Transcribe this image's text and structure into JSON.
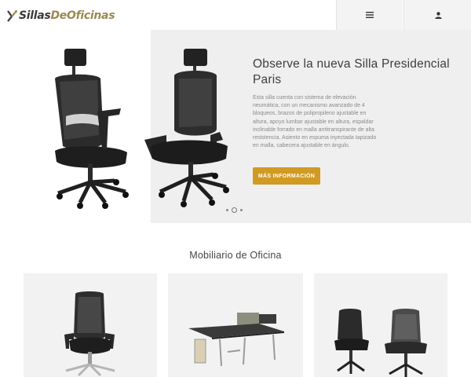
{
  "header": {
    "logo": {
      "part1": "Sillas",
      "part2": "DeOficinas"
    },
    "icons": {
      "menu": "hamburger-menu-icon",
      "user": "user-icon"
    },
    "colors": {
      "logo_dark": "#3a3a3a",
      "logo_gold": "#9a8a52",
      "button_bg": "#f3f3f3"
    }
  },
  "hero": {
    "title": "Observe la nueva Silla Presidencial Paris",
    "description": "Esta silla cuenta con sistema de elevación neumática, con un mecanismo avanzado de 4 bloqueos, brazos de polipropileno ajustable en altura, apoyo lumbar ajustable en altura, espaldar inclinable forrado en malla antitranspirante de alta resistencia. Asiento en espuma inyectada tapizado en malla, cabecera ajustable en ángulo.",
    "cta_label": "MÁS INFORMACIÓN",
    "slides": 3,
    "active_slide": 2,
    "colors": {
      "accent": "#d09a23",
      "panel_bg": "#efefef"
    }
  },
  "products": {
    "section_title": "Mobiliario de Oficina",
    "cards": [
      {
        "image": "mesh-office-chair-image"
      },
      {
        "image": "office-workstation-desk-image"
      },
      {
        "image": "pair-of-office-chairs-image"
      }
    ]
  }
}
